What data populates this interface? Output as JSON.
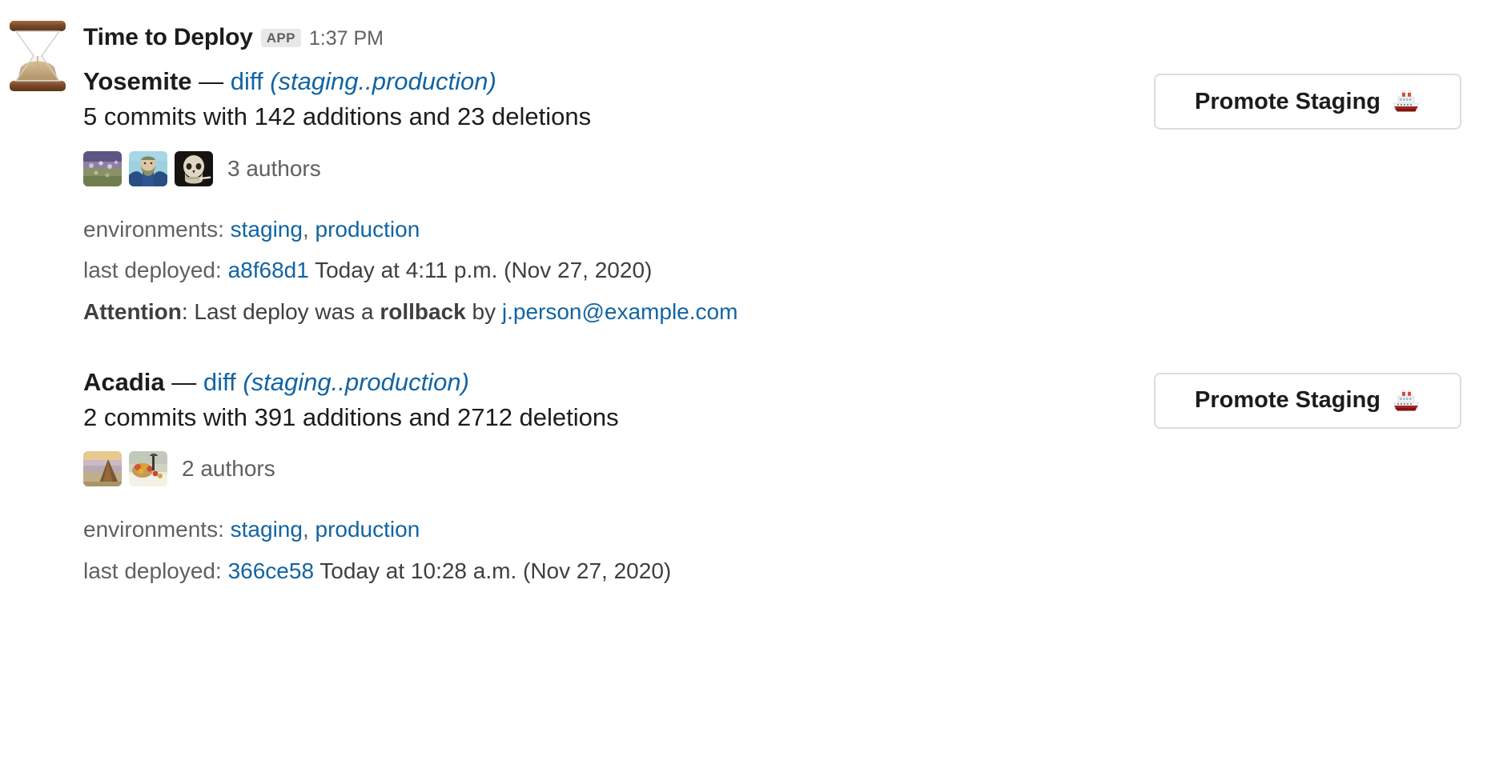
{
  "message": {
    "app_avatar_icon": "hourglass-emoji",
    "sender": "Time to Deploy",
    "app_badge": "APP",
    "timestamp": "1:37 PM",
    "attachments": [
      {
        "repo": "Yosemite",
        "separator": "—",
        "diff_label": "diff",
        "diff_range": "(staging..production)",
        "summary": "5 commits with 142 additions and 23 deletions",
        "authors_count": "3 authors",
        "author_avatars": [
          "water-lilies-painting-avatar",
          "portrait-of-joseph-roulin-avatar",
          "skull-with-cigarette-avatar"
        ],
        "environments_label": "environments:",
        "environments": [
          "staging",
          "production"
        ],
        "environments_separator": ", ",
        "last_deployed_label": "last deployed:",
        "last_deployed_sha": "a8f68d1",
        "last_deployed_when": "Today at 4:11 p.m. (Nov 27, 2020)",
        "attention_label": "Attention",
        "attention_colon": ": ",
        "attention_text_before": "Last deploy was a ",
        "attention_kind": "rollback",
        "attention_text_after": " by ",
        "attention_actor": "j.person@example.com",
        "button": {
          "label": "Promote Staging",
          "emoji_icon": "ship-emoji"
        }
      },
      {
        "repo": "Acadia",
        "separator": "—",
        "diff_label": "diff",
        "diff_range": "(staging..production)",
        "summary": "2 commits with 391 additions and 2712 deletions",
        "authors_count": "2 authors",
        "author_avatars": [
          "haystacks-sunset-painting-avatar",
          "still-life-with-fruit-basket-avatar"
        ],
        "environments_label": "environments:",
        "environments": [
          "staging",
          "production"
        ],
        "environments_separator": ", ",
        "last_deployed_label": "last deployed:",
        "last_deployed_sha": "366ce58",
        "last_deployed_when": "Today at 10:28 a.m. (Nov 27, 2020)",
        "button": {
          "label": "Promote Staging",
          "emoji_icon": "ship-emoji"
        }
      }
    ]
  },
  "colors": {
    "link": "#1264a3",
    "text": "#1d1c1d",
    "muted": "#616061",
    "badge_bg": "#e8e8e8",
    "button_border": "#ddddde",
    "background": "#ffffff"
  }
}
